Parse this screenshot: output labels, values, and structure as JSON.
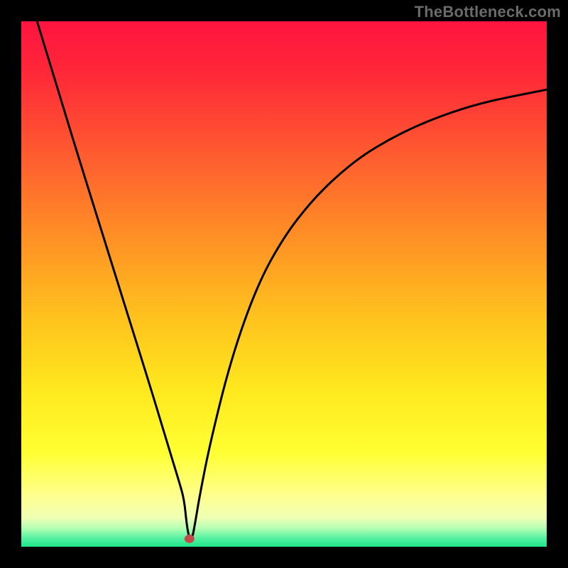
{
  "watermark": "TheBottleneck.com",
  "chart_data": {
    "type": "line",
    "title": "",
    "xlabel": "",
    "ylabel": "",
    "xlim": [
      0,
      100
    ],
    "ylim": [
      0,
      100
    ],
    "grid": false,
    "legend": false,
    "annotations": [],
    "background_gradient": {
      "top_color": "#ff143c",
      "mid_colors": [
        "#ff5a32",
        "#ff9628",
        "#ffc81e",
        "#fff51e",
        "#ffff64"
      ],
      "bottom_color": "#1ee68c"
    },
    "series": [
      {
        "name": "bottleneck-curve",
        "color": "#000000",
        "x": [
          3,
          5,
          10,
          15,
          20,
          25,
          28,
          30,
          31,
          31.5,
          32,
          32.5,
          33,
          34,
          36,
          40,
          45,
          50,
          55,
          60,
          65,
          70,
          75,
          80,
          85,
          90,
          95,
          100
        ],
        "y": [
          100,
          93.5,
          77,
          61,
          45,
          29,
          19,
          12.5,
          9,
          4,
          1.5,
          1.5,
          4,
          10,
          20,
          36,
          50,
          59,
          65.5,
          70.5,
          74.5,
          77.5,
          80,
          82,
          83.7,
          85,
          86,
          87
        ]
      }
    ],
    "marker": {
      "name": "optimal-point",
      "x": 32,
      "y": 1.5,
      "color": "#c24a48",
      "radius_px": 7
    }
  }
}
